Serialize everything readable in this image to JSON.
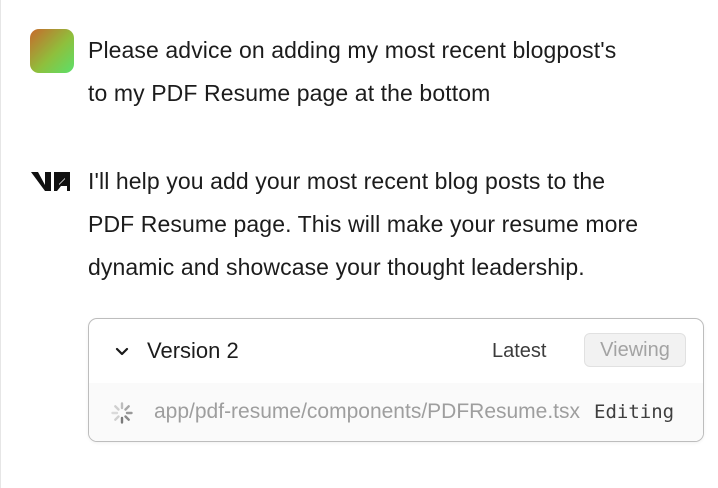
{
  "conversation": {
    "user_message": {
      "avatar_icon": "user-gradient-avatar",
      "text_line1": "Please advice on adding my most recent blogpost's",
      "text_line2": "to my PDF Resume page at the bottom"
    },
    "assistant_message": {
      "logo_icon": "v0-logo-icon",
      "text_line1": "I'll help you add your most recent blog posts to the",
      "text_line2": "PDF Resume page. This will make your resume more",
      "text_line3": "dynamic and showcase your thought leadership."
    }
  },
  "version_card": {
    "title": "Version 2",
    "latest_label": "Latest",
    "viewing_label": "Viewing",
    "expand_icon": "chevron-down-icon",
    "file": {
      "path": "app/pdf-resume/components/PDFResume.tsx",
      "status": "Editing",
      "status_icon": "loading-spinner-icon"
    }
  },
  "colors": {
    "avatar_gradient_start": "#c76a2c",
    "avatar_gradient_end": "#5be06a",
    "card_border": "#bdbdbd",
    "muted_text": "#9e9e9e"
  }
}
